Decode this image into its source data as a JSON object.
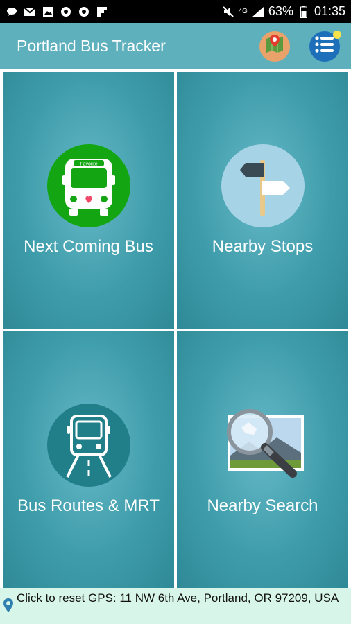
{
  "status_bar": {
    "battery": "63%",
    "time": "01:35",
    "network": "4G"
  },
  "app_bar": {
    "title": "Portland Bus Tracker"
  },
  "tiles": [
    {
      "label": "Next Coming Bus",
      "icon": "bus-icon",
      "sign": "Favorite",
      "color": "#13a612"
    },
    {
      "label": "Nearby Stops",
      "icon": "signpost-icon",
      "color": "#a7d3e6"
    },
    {
      "label": "Bus Routes & MRT",
      "icon": "bus-route-icon",
      "color": "#217f8a"
    },
    {
      "label": "Nearby Search",
      "icon": "magnifier-photo-icon"
    }
  ],
  "footer": {
    "text": "Click to reset GPS: 11 NW 6th Ave, Portland, OR 97209, USA"
  }
}
